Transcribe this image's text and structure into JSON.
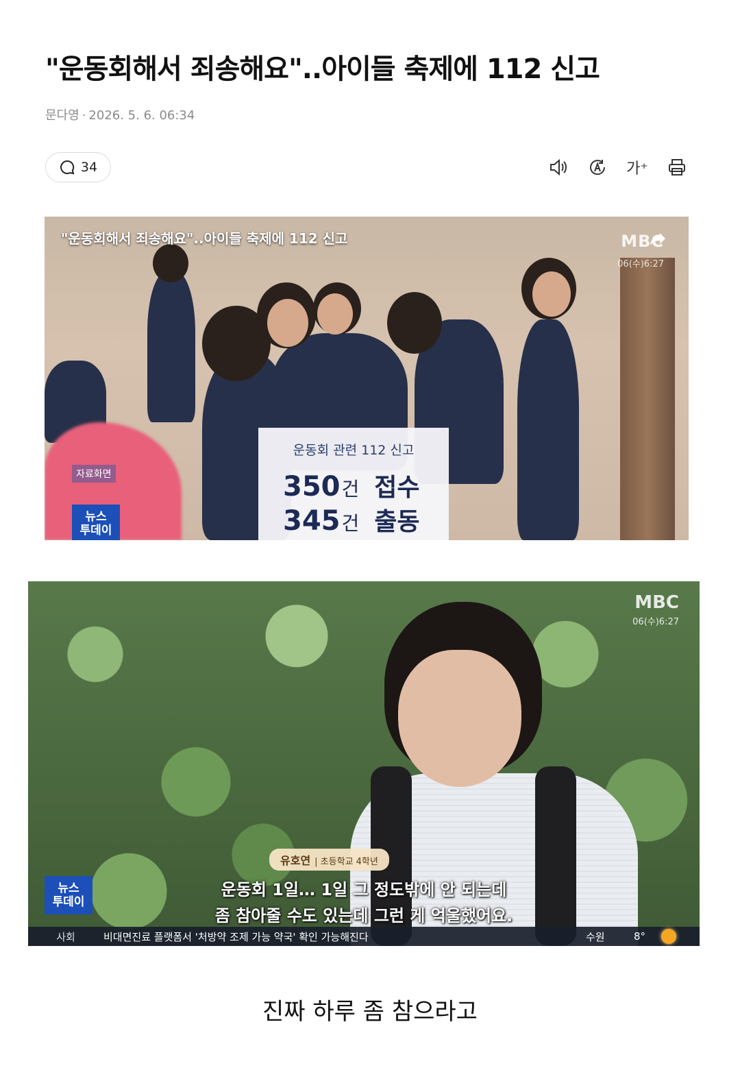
{
  "article": {
    "headline": "\"운동회해서 죄송해요\"..아이들 축제에 112 신고",
    "author": "문다영",
    "separator": "·",
    "datetime": "2026. 5. 6. 06:34"
  },
  "toolbar": {
    "comment_count": "34",
    "icons": [
      "speaker-icon",
      "translate-icon",
      "font-size-icon",
      "print-icon"
    ],
    "font_size_label": "가⁺"
  },
  "video1": {
    "title": "\"운동회해서 죄송해요\"..아이들 축제에 112 신고",
    "logo": "MBC",
    "time": "06(수)6:27",
    "data_tag": "자료화면",
    "news_logo_line1": "뉴스",
    "news_logo_line2": "투데이",
    "stat_caption": "운동회 관련 112 신고",
    "stat1_num": "350",
    "stat1_unit": "건",
    "stat1_word": "접수",
    "stat2_num": "345",
    "stat2_unit": "건",
    "stat2_word": "출동"
  },
  "video2": {
    "logo": "MBC",
    "time": "06(수)6:27",
    "name": "유호연",
    "role": "| 초등학교 4학년",
    "subtitle_line1": "운동회 1일… 1일 그 정도밖에 안 되는데",
    "subtitle_line2": "좀 참아줄 수도 있는데 그런 게 억울했어요.",
    "news_logo_line1": "뉴스",
    "news_logo_line2": "투데이",
    "ticker_category": "사회",
    "ticker_text": "비대면진료 플랫폼서 '처방약 조제 가능 약국' 확인 가능해진다",
    "ticker_city": "수원",
    "ticker_temp": "8°"
  },
  "caption": "진짜 하루 좀 참으라고"
}
